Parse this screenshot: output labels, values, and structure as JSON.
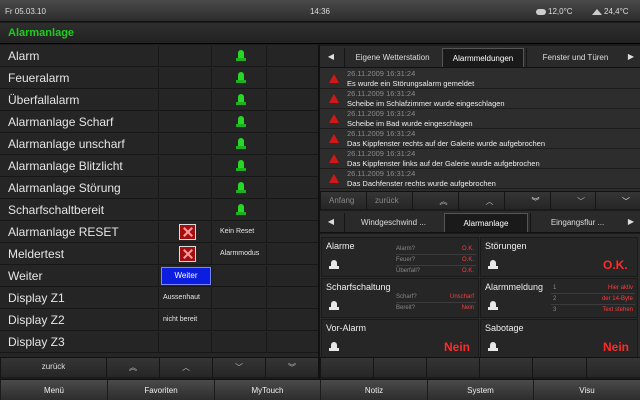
{
  "status": {
    "date": "Fr 05.03.10",
    "time": "14:36",
    "outdoor_temp": "12,0°C",
    "indoor_temp": "24,4°C"
  },
  "page": {
    "title": "Alarmanlage"
  },
  "left": {
    "rows": [
      {
        "label": "Alarm",
        "c1": "",
        "c2_icon": "green-bell"
      },
      {
        "label": "Feueralarm",
        "c1": "",
        "c2_icon": "green-bell"
      },
      {
        "label": "Überfallalarm",
        "c1": "",
        "c2_icon": "green-bell"
      },
      {
        "label": "Alarmanlage Scharf",
        "c1": "",
        "c2_icon": "green-bell"
      },
      {
        "label": "Alarmanlage unscharf",
        "c1": "",
        "c2_icon": "green-bell"
      },
      {
        "label": "Alarmanlage Blitzlicht",
        "c1": "",
        "c2_icon": "green-bell"
      },
      {
        "label": "Alarmanlage Störung",
        "c1": "",
        "c2_icon": "green-bell"
      },
      {
        "label": "Scharfschaltbereit",
        "c1": "",
        "c2_icon": "green-bell"
      },
      {
        "label": "Alarmanlage RESET",
        "c1_icon": "red-x",
        "c2": "Kein Reset"
      },
      {
        "label": "Meldertest",
        "c1_icon": "red-x",
        "c2": "Alarmmodus"
      },
      {
        "label": "Weiter",
        "c1_button": "Weiter",
        "c2": ""
      },
      {
        "label": "Display Z1",
        "c1": "Aussenhaut",
        "c2": ""
      },
      {
        "label": "Display Z2",
        "c1": "nicht bereit",
        "c2": ""
      },
      {
        "label": "Display Z3",
        "c1": "",
        "c2": ""
      }
    ],
    "nav_back": "zurück"
  },
  "tabs_top": [
    "Eigene Wetterstation",
    "Alarmmeldungen",
    "Fenster und Türen"
  ],
  "tabs_top_active": "Alarmmeldungen",
  "messages": [
    {
      "ts": "26.11.2009 16:31:24",
      "text": "Es wurde ein Störungsalarm gemeldet"
    },
    {
      "ts": "26.11.2009 16:31:24",
      "text": "Scheibe im Schlafzimmer wurde eingeschlagen"
    },
    {
      "ts": "26.11.2009 16:31:24",
      "text": "Scheibe im Bad wurde eingeschlagen"
    },
    {
      "ts": "26.11.2009 16:31:24",
      "text": "Das Kippfenster rechts auf der Galerie wurde aufgebrochen"
    },
    {
      "ts": "26.11.2009 16:31:24",
      "text": "Das Kippfenster links auf der Galerie wurde aufgebrochen"
    },
    {
      "ts": "26.11.2009 16:31:24",
      "text": "Das Dachfenster rechts wurde aufgebrochen"
    }
  ],
  "msgnav": {
    "start": "Anfang",
    "back": "zurück"
  },
  "tabs_bottom": [
    "Windgeschwind ...",
    "Alarmanlage",
    "Eingangsflur ..."
  ],
  "tabs_bottom_active": "Alarmanlage",
  "panels": {
    "alarme": {
      "title": "Alarme",
      "rows": [
        {
          "k": "Alarm?",
          "v": "O.K."
        },
        {
          "k": "Feuer?",
          "v": "O.K."
        },
        {
          "k": "Überfall?",
          "v": "O.K."
        }
      ]
    },
    "stoerungen": {
      "title": "Störungen",
      "value": "O.K."
    },
    "scharf": {
      "title": "Scharfschaltung",
      "rows": [
        {
          "k": "Scharf?",
          "v": "Unscharf"
        },
        {
          "k": "Bereit?",
          "v": "Nein"
        }
      ]
    },
    "alarmmeldung": {
      "title": "Alarmmeldung",
      "rows": [
        {
          "k": "1",
          "v": "Hier aktiv"
        },
        {
          "k": "2",
          "v": "der 14-Byte"
        },
        {
          "k": "3",
          "v": "Text stehen"
        }
      ]
    },
    "voralarm": {
      "title": "Vor-Alarm",
      "value": "Nein"
    },
    "sabotage": {
      "title": "Sabotage",
      "value": "Nein"
    }
  },
  "menu": [
    "Menü",
    "Favoriten",
    "MyTouch",
    "Notiz",
    "System",
    "Visu"
  ],
  "colors": {
    "accent_green": "#1ecc1e",
    "alert_red": "#ff2a2a",
    "button_blue": "#0b1ee0"
  }
}
